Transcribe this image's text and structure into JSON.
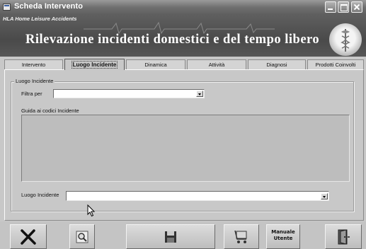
{
  "window": {
    "title": "Scheda Intervento"
  },
  "banner": {
    "subtitle": "HLA Home Leisure Accidents",
    "title": "Rilevazione incidenti domestici e del tempo libero"
  },
  "tabs": [
    {
      "label": "Intervento",
      "active": false
    },
    {
      "label": "Luogo Incidente",
      "active": true
    },
    {
      "label": "Dinamica",
      "active": false
    },
    {
      "label": "Attività",
      "active": false
    },
    {
      "label": "Diagnosi",
      "active": false
    },
    {
      "label": "Prodotti Coinvolti",
      "active": false
    }
  ],
  "form": {
    "group_title": "Luogo Incidente",
    "filter_label": "Filtra per",
    "filter_value": "",
    "guide_label": "Guida ai codici Incidente",
    "luogo_label": "Luogo Incidente",
    "luogo_value": ""
  },
  "toolbar": {
    "manual_line1": "Manuale",
    "manual_line2": "Utente",
    "buttons": [
      "close-x-icon",
      "zoom-preview-icon",
      "save-disk-icon",
      "cart-icon",
      "manual-book",
      "exit-door-icon"
    ]
  },
  "colors": {
    "window_bg": "#c8c8c8",
    "banner_bg": "#555555",
    "title_text": "#ffffff"
  }
}
